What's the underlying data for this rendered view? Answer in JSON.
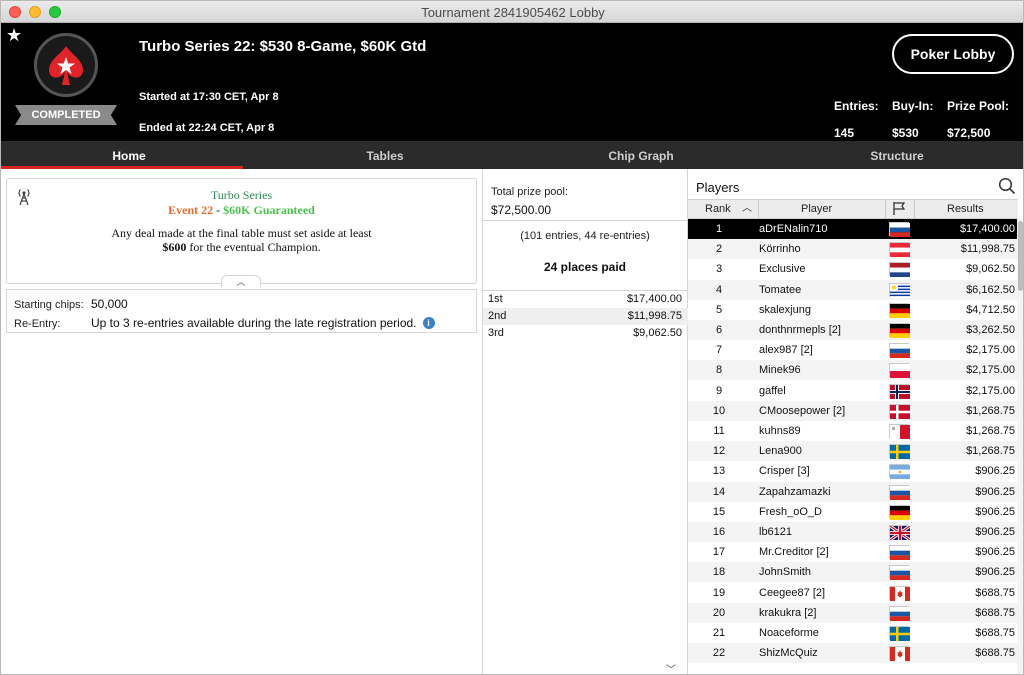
{
  "window": {
    "title": "Tournament 2841905462 Lobby"
  },
  "header": {
    "status": "COMPLETED",
    "tournament_name": "Turbo Series 22: $530 8-Game, $60K Gtd",
    "started": "Started at 17:30 CET, Apr 8",
    "ended": "Ended at 22:24 CET, Apr 8",
    "lobby_button": "Poker Lobby",
    "entries_label": "Entries:",
    "entries_value": "145",
    "buyin_label": "Buy-In:",
    "buyin_value": "$530",
    "prizepool_label": "Prize Pool:",
    "prizepool_value": "$72,500"
  },
  "tabs": [
    {
      "label": "Home",
      "active": true
    },
    {
      "label": "Tables",
      "active": false
    },
    {
      "label": "Chip Graph",
      "active": false
    },
    {
      "label": "Structure",
      "active": false
    }
  ],
  "home": {
    "series": "Turbo Series",
    "event": "Event 22",
    "dash": "-",
    "guarantee": "$60K Guaranteed",
    "deal_line1": "Any deal made at the final table must set aside at least",
    "deal_amount": "$600",
    "deal_line2": " for the eventual Champion.",
    "starting_chips_label": "Starting chips:",
    "starting_chips_value": "50,000",
    "reentry_label": "Re-Entry:",
    "reentry_value": "Up to 3 re-entries available during the late registration period."
  },
  "prize": {
    "total_label": "Total prize pool:",
    "total_value": "$72,500.00",
    "entries_note": "(101 entries, 44 re-entries)",
    "places_paid": "24 places paid",
    "payouts": [
      {
        "place": "1st",
        "amount": "$17,400.00"
      },
      {
        "place": "2nd",
        "amount": "$11,998.75"
      },
      {
        "place": "3rd",
        "amount": "$9,062.50"
      }
    ]
  },
  "players": {
    "title": "Players",
    "col_rank": "Rank",
    "col_player": "Player",
    "col_results": "Results",
    "rows": [
      {
        "rank": "1",
        "name": "aDrENalin710",
        "flag": "russia",
        "result": "$17,400.00"
      },
      {
        "rank": "2",
        "name": "Körrinho",
        "flag": "austria",
        "result": "$11,998.75"
      },
      {
        "rank": "3",
        "name": "Exclusive",
        "flag": "netherlands",
        "result": "$9,062.50"
      },
      {
        "rank": "4",
        "name": "Tomatee",
        "flag": "uruguay",
        "result": "$6,162.50"
      },
      {
        "rank": "5",
        "name": "skalexjung",
        "flag": "germany",
        "result": "$4,712.50"
      },
      {
        "rank": "6",
        "name": "donthnrmepls [2]",
        "flag": "germany",
        "result": "$3,262.50"
      },
      {
        "rank": "7",
        "name": "alex987 [2]",
        "flag": "russia",
        "result": "$2,175.00"
      },
      {
        "rank": "8",
        "name": "Minek96",
        "flag": "poland",
        "result": "$2,175.00"
      },
      {
        "rank": "9",
        "name": "gaffel",
        "flag": "norway",
        "result": "$2,175.00"
      },
      {
        "rank": "10",
        "name": "CMoosepower [2]",
        "flag": "denmark",
        "result": "$1,268.75"
      },
      {
        "rank": "11",
        "name": "kuhns89",
        "flag": "malta",
        "result": "$1,268.75"
      },
      {
        "rank": "12",
        "name": "Lena900",
        "flag": "sweden",
        "result": "$1,268.75"
      },
      {
        "rank": "13",
        "name": "Crisper [3]",
        "flag": "argentina",
        "result": "$906.25"
      },
      {
        "rank": "14",
        "name": "Zapahzamazki",
        "flag": "russia",
        "result": "$906.25"
      },
      {
        "rank": "15",
        "name": "Fresh_oO_D",
        "flag": "germany",
        "result": "$906.25"
      },
      {
        "rank": "16",
        "name": "lb6121",
        "flag": "uk",
        "result": "$906.25"
      },
      {
        "rank": "17",
        "name": "Mr.Creditor [2]",
        "flag": "russia",
        "result": "$906.25"
      },
      {
        "rank": "18",
        "name": "JohnSmith",
        "flag": "russia",
        "result": "$906.25"
      },
      {
        "rank": "19",
        "name": "Ceegee87 [2]",
        "flag": "canada",
        "result": "$688.75"
      },
      {
        "rank": "20",
        "name": "krakukra [2]",
        "flag": "russia",
        "result": "$688.75"
      },
      {
        "rank": "21",
        "name": "Noaceforme",
        "flag": "sweden",
        "result": "$688.75"
      },
      {
        "rank": "22",
        "name": "ShizMcQuiz",
        "flag": "canada",
        "result": "$688.75"
      }
    ]
  },
  "colors": {
    "accent_red": "#d7261e",
    "series_green": "#2e8b57",
    "event_orange": "#e46a2c",
    "guarantee_green": "#4cc04c",
    "info_blue": "#3b7fc4"
  }
}
